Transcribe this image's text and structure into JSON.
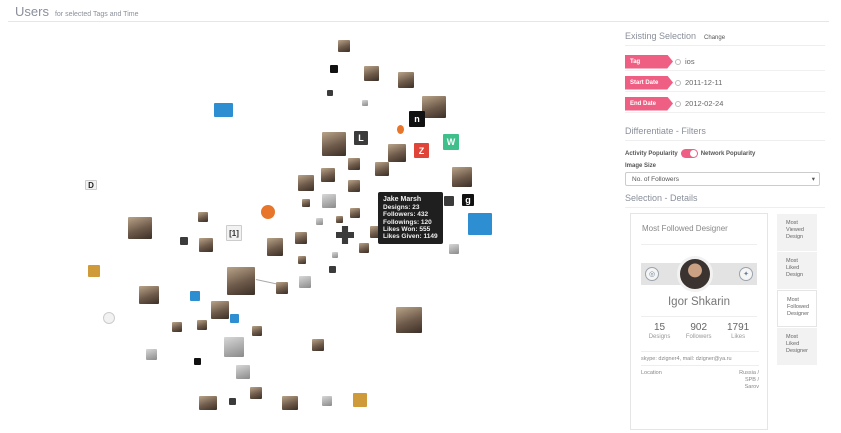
{
  "header": {
    "title": "Users",
    "subtitle": "for selected Tags and Time"
  },
  "tooltip": {
    "name": "Jake Marsh",
    "lines": [
      "Designs: 23",
      "Followers: 432",
      "Followings: 120",
      "Likes Won: 555",
      "Likes Given: 1149"
    ]
  },
  "panel": {
    "existing_selection": {
      "title": "Existing Selection",
      "change_label": "Change",
      "rows": [
        {
          "label": "Tag",
          "value": "ios"
        },
        {
          "label": "Start Date",
          "value": "2011-12-11"
        },
        {
          "label": "End Date",
          "value": "2012-02-24"
        }
      ]
    },
    "filters": {
      "title": "Differentiate - Filters",
      "toggle_left": "Activity Popularity",
      "toggle_right": "Network Popularity",
      "image_size_label": "Image Size",
      "image_size_value": "No. of Followers"
    },
    "details": {
      "title": "Selection - Details"
    }
  },
  "card": {
    "title": "Most Followed Designer",
    "name": "Igor Shkarin",
    "stats": [
      {
        "num": "15",
        "label": "Designs"
      },
      {
        "num": "902",
        "label": "Followers"
      },
      {
        "num": "1791",
        "label": "Likes"
      }
    ],
    "contact": "skype: dzigner4, mail: dzigner@ya.ru",
    "location_label": "Location",
    "location_value": [
      "Russia /",
      "SPB /",
      "Sarov"
    ]
  },
  "tabs": [
    {
      "lines": [
        "Most",
        "Viewed",
        "Design"
      ],
      "active": false
    },
    {
      "lines": [
        "Most",
        "Liked",
        "Design"
      ],
      "active": false
    },
    {
      "lines": [
        "Most",
        "Followed",
        "Designer"
      ],
      "active": true
    },
    {
      "lines": [
        "Most",
        "Liked",
        "Designer"
      ],
      "active": false
    }
  ],
  "colors": {
    "accent": "#ef5f83",
    "title": "#8a8f9a"
  }
}
